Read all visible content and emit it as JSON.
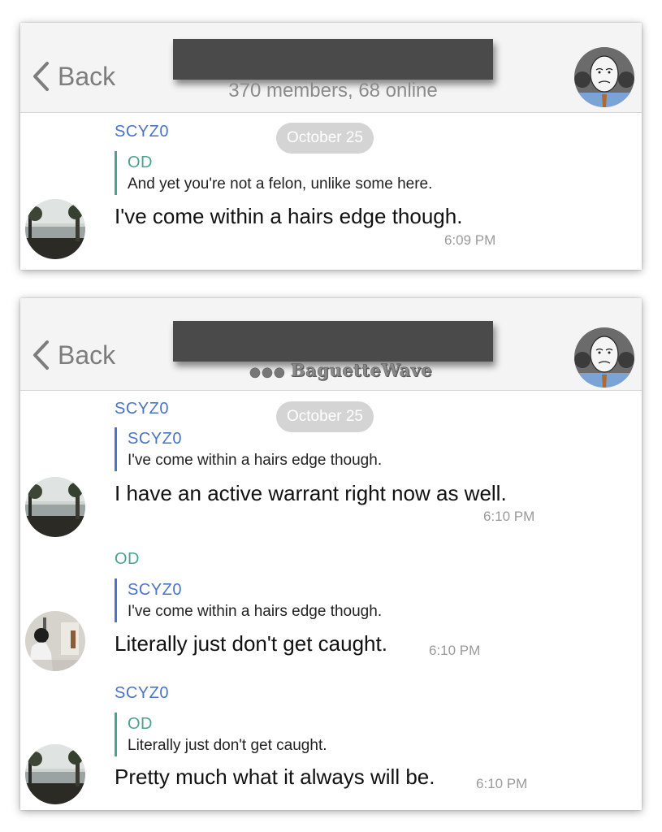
{
  "screens": [
    {
      "header": {
        "back_label": "Back",
        "subtitle": "370 members, 68 online"
      },
      "date": "October 25",
      "sender": "SCYZ0",
      "reply": {
        "name": "OD",
        "text": "And yet you're not a felon, unlike some here."
      },
      "message": "I've come within a hairs edge though.",
      "time": "6:09 PM"
    },
    {
      "header": {
        "back_label": "Back",
        "typing": "BaguetteWave"
      },
      "date": "October 25",
      "messages": [
        {
          "sender": "SCYZ0",
          "reply": {
            "name": "SCYZ0",
            "text": "I've come within a hairs edge though."
          },
          "message": "I have an active warrant right now as well.",
          "time": "6:10 PM"
        },
        {
          "sender": "OD",
          "reply": {
            "name": "SCYZ0",
            "text": "I've come within a hairs edge though."
          },
          "message": "Literally just don't get caught.",
          "time": "6:10 PM"
        },
        {
          "sender": "SCYZ0",
          "reply": {
            "name": "OD",
            "text": "Literally just don't get caught."
          },
          "message": "Pretty much what it always will be.",
          "time": "6:10 PM"
        }
      ]
    }
  ],
  "colors": {
    "scyzo": "#4a74c8",
    "od": "#4aa38f",
    "date_pill": "#d4d4d4",
    "header_bg": "#f4f4f4"
  },
  "icons": {
    "back": "chevron-left-icon",
    "group_avatar": "wojak-avatar",
    "scyzo_avatar": "lake-landscape-avatar",
    "od_avatar": "person-photo-avatar"
  }
}
